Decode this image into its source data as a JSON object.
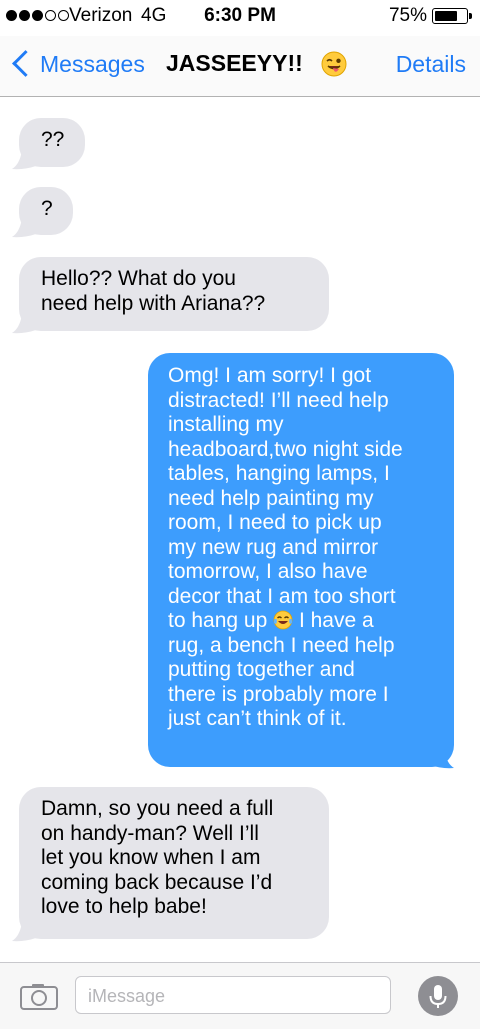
{
  "status_bar": {
    "signal_dots": [
      true,
      true,
      true,
      false,
      false
    ],
    "carrier": "Verizon",
    "network": "4G",
    "time": "6:30 PM",
    "battery_percent": "75%",
    "battery_level": 0.75
  },
  "nav": {
    "back_label": "Messages",
    "title": "JASSEEYY!!",
    "title_emoji": "winking-face-with-tongue-icon",
    "details_label": "Details"
  },
  "messages": [
    {
      "direction": "received",
      "text": "??"
    },
    {
      "direction": "received",
      "text": "?"
    },
    {
      "direction": "received",
      "text": "Hello?? What do you\nneed help with Ariana??"
    },
    {
      "direction": "sent",
      "text": "Omg! I am sorry! I got\ndistracted! I’ll need help\ninstalling my\nheadboard,two night side\ntables, hanging lamps, I\nneed help painting my\nroom, I need to pick up\nmy new rug and mirror\ntomorrow, I also have\ndecor that I am too short\nto hang up",
      "text_after_emoji": " I have a\nrug, a bench I need help\nputting together and\nthere is probably more I\njust can’t think of it.",
      "inline_emoji": "tears-of-joy-icon"
    },
    {
      "direction": "received",
      "text": "Damn, so you need a full\non handy-man? Well I’ll\nlet you know when I am\ncoming back because I’d\nlove to help babe!"
    }
  ],
  "input_bar": {
    "camera_icon": "camera-icon",
    "placeholder": "iMessage",
    "mic_icon": "microphone-icon"
  },
  "colors": {
    "accent": "#1f7bf6",
    "sent_bubble": "#3d9dfd",
    "received_bubble": "#e5e5ea"
  }
}
